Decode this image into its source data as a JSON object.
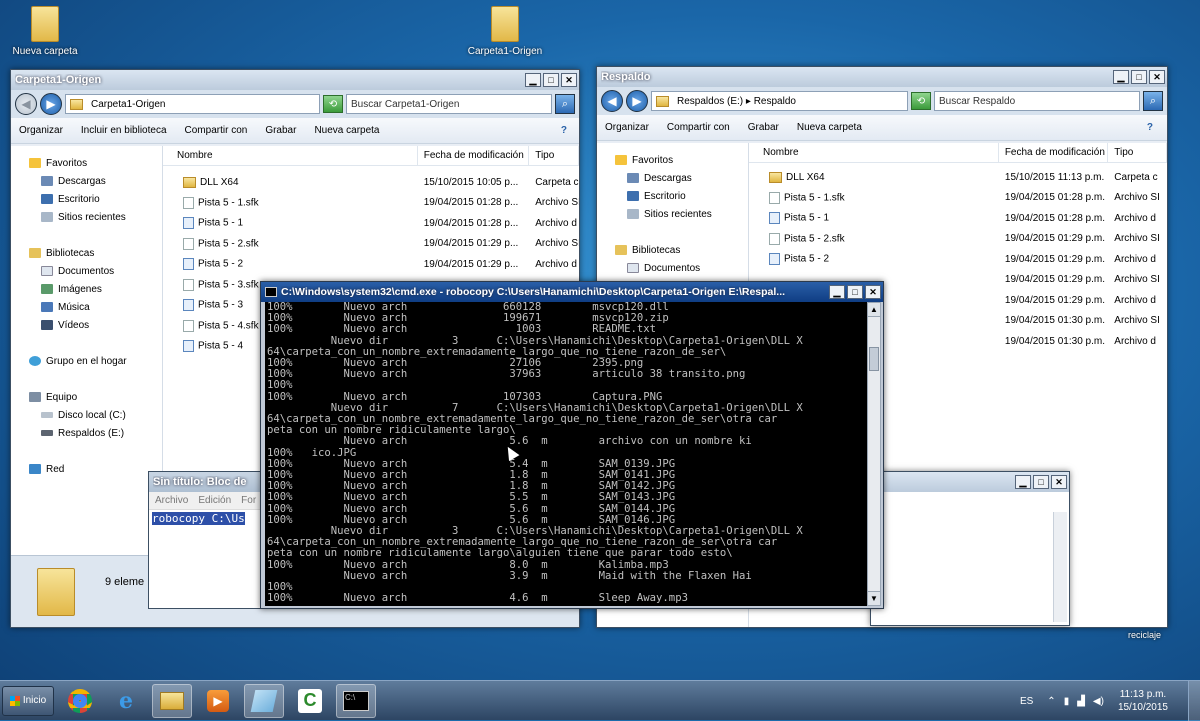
{
  "desktop": {
    "icons": [
      "Nueva carpeta",
      "Carpeta1-Origen"
    ],
    "recycle_partial": "reciclaje"
  },
  "explorer_left": {
    "title": "Carpeta1-Origen",
    "address": "Carpeta1-Origen",
    "search_placeholder": "Buscar Carpeta1-Origen",
    "commands": [
      "Organizar",
      "Incluir en biblioteca",
      "Compartir con",
      "Grabar",
      "Nueva carpeta"
    ],
    "nav": {
      "favoritos": "Favoritos",
      "fav_items": [
        "Descargas",
        "Escritorio",
        "Sitios recientes"
      ],
      "bibliotecas": "Bibliotecas",
      "lib_items": [
        "Documentos",
        "Imágenes",
        "Música",
        "Vídeos"
      ],
      "grupo": "Grupo en el hogar",
      "equipo": "Equipo",
      "eq_items": [
        "Disco local (C:)",
        "Respaldos (E:)"
      ],
      "red": "Red"
    },
    "columns": [
      "Nombre",
      "Fecha de modificación",
      "Tipo"
    ],
    "rows": [
      {
        "name": "DLL X64",
        "date": "15/10/2015 10:05 p...",
        "type": "Carpeta c",
        "icon": "folder"
      },
      {
        "name": "Pista 5 - 1.sfk",
        "date": "19/04/2015 01:28 p...",
        "type": "Archivo SI",
        "icon": "file"
      },
      {
        "name": "Pista 5 - 1",
        "date": "19/04/2015 01:28 p...",
        "type": "Archivo d",
        "icon": "music"
      },
      {
        "name": "Pista 5 - 2.sfk",
        "date": "19/04/2015 01:29 p...",
        "type": "Archivo SI",
        "icon": "file"
      },
      {
        "name": "Pista 5 - 2",
        "date": "19/04/2015 01:29 p...",
        "type": "Archivo d",
        "icon": "music"
      },
      {
        "name": "Pista 5 - 3.sfk",
        "date": "",
        "type": "",
        "icon": "file"
      },
      {
        "name": "Pista 5 - 3",
        "date": "",
        "type": "",
        "icon": "music"
      },
      {
        "name": "Pista 5 - 4.sfk",
        "date": "",
        "type": "",
        "icon": "file"
      },
      {
        "name": "Pista 5 - 4",
        "date": "",
        "type": "",
        "icon": "music"
      }
    ],
    "status": "9 eleme"
  },
  "explorer_right": {
    "title": "Respaldo",
    "address": "Respaldos (E:)  ▸  Respaldo",
    "search_placeholder": "Buscar Respaldo",
    "commands": [
      "Organizar",
      "Compartir con",
      "Grabar",
      "Nueva carpeta"
    ],
    "nav": {
      "favoritos": "Favoritos",
      "fav_items": [
        "Descargas",
        "Escritorio",
        "Sitios recientes"
      ],
      "bibliotecas": "Bibliotecas",
      "lib_items": [
        "Documentos"
      ]
    },
    "columns": [
      "Nombre",
      "Fecha de modificación",
      "Tipo"
    ],
    "rows": [
      {
        "name": "DLL X64",
        "date": "15/10/2015 11:13 p.m.",
        "type": "Carpeta c",
        "icon": "folder"
      },
      {
        "name": "Pista 5 - 1.sfk",
        "date": "19/04/2015 01:28 p.m.",
        "type": "Archivo SI",
        "icon": "file"
      },
      {
        "name": "Pista 5 - 1",
        "date": "19/04/2015 01:28 p.m.",
        "type": "Archivo d",
        "icon": "music"
      },
      {
        "name": "Pista 5 - 2.sfk",
        "date": "19/04/2015 01:29 p.m.",
        "type": "Archivo SI",
        "icon": "file"
      },
      {
        "name": "Pista 5 - 2",
        "date": "19/04/2015 01:29 p.m.",
        "type": "Archivo d",
        "icon": "music"
      },
      {
        "name": "",
        "date": "19/04/2015 01:29 p.m.",
        "type": "Archivo SI",
        "icon": "none"
      },
      {
        "name": "",
        "date": "19/04/2015 01:29 p.m.",
        "type": "Archivo d",
        "icon": "none"
      },
      {
        "name": "",
        "date": "19/04/2015 01:30 p.m.",
        "type": "Archivo SI",
        "icon": "none"
      },
      {
        "name": "",
        "date": "19/04/2015 01:30 p.m.",
        "type": "Archivo d",
        "icon": "none"
      }
    ]
  },
  "notepad": {
    "title": "Sin título: Bloc de",
    "menu": [
      "Archivo",
      "Edición",
      "For"
    ],
    "text": "robocopy C:\\Us"
  },
  "cmd": {
    "title": "C:\\Windows\\system32\\cmd.exe - robocopy  C:\\Users\\Hanamichi\\Desktop\\Carpeta1-Origen E:\\Respal...",
    "lines": [
      "100%        Nuevo arch               660128        msvcp120.dll",
      "100%        Nuevo arch               199671        msvcp120.zip",
      "100%        Nuevo arch                 1003        README.txt",
      "          Nuevo dir          3      C:\\Users\\Hanamichi\\Desktop\\Carpeta1-Origen\\DLL X",
      "64\\carpeta_con_un_nombre_extremadamente_largo_que_no_tiene_razon_de_ser\\",
      "100%        Nuevo arch                27106        2395.png",
      "100%        Nuevo arch                37963        articulo 38 transito.png",
      "100%",
      "100%        Nuevo arch               107303        Captura.PNG",
      "          Nuevo dir          7      C:\\Users\\Hanamichi\\Desktop\\Carpeta1-Origen\\DLL X",
      "64\\carpeta_con_un_nombre_extremadamente_largo_que_no_tiene_razon_de_ser\\otra car",
      "peta con un nombre ridiculamente largo\\",
      "            Nuevo arch                5.6  m        archivo con un nombre ki",
      "100%   ico.JPG",
      "100%        Nuevo arch                5.4  m        SAM_0139.JPG",
      "100%        Nuevo arch                1.8  m        SAM_0141.JPG",
      "100%        Nuevo arch                1.8  m        SAM_0142.JPG",
      "100%        Nuevo arch                5.5  m        SAM_0143.JPG",
      "100%        Nuevo arch                5.6  m        SAM_0144.JPG",
      "100%        Nuevo arch                5.6  m        SAM_0146.JPG",
      "          Nuevo dir          3      C:\\Users\\Hanamichi\\Desktop\\Carpeta1-Origen\\DLL X",
      "64\\carpeta_con_un_nombre_extremadamente_largo_que_no_tiene_razon_de_ser\\otra car",
      "peta con un nombre ridiculamente largo\\alguien tiene que parar todo esto\\",
      "100%        Nuevo arch                8.0  m        Kalimba.mp3",
      "            Nuevo arch                3.9  m        Maid with the Flaxen Hai",
      "100%",
      "100%        Nuevo arch                4.6  m        Sleep Away.mp3"
    ]
  },
  "taskbar": {
    "start_label": "Inicio",
    "language": "ES",
    "time": "11:13 p.m.",
    "date": "15/10/2015"
  }
}
